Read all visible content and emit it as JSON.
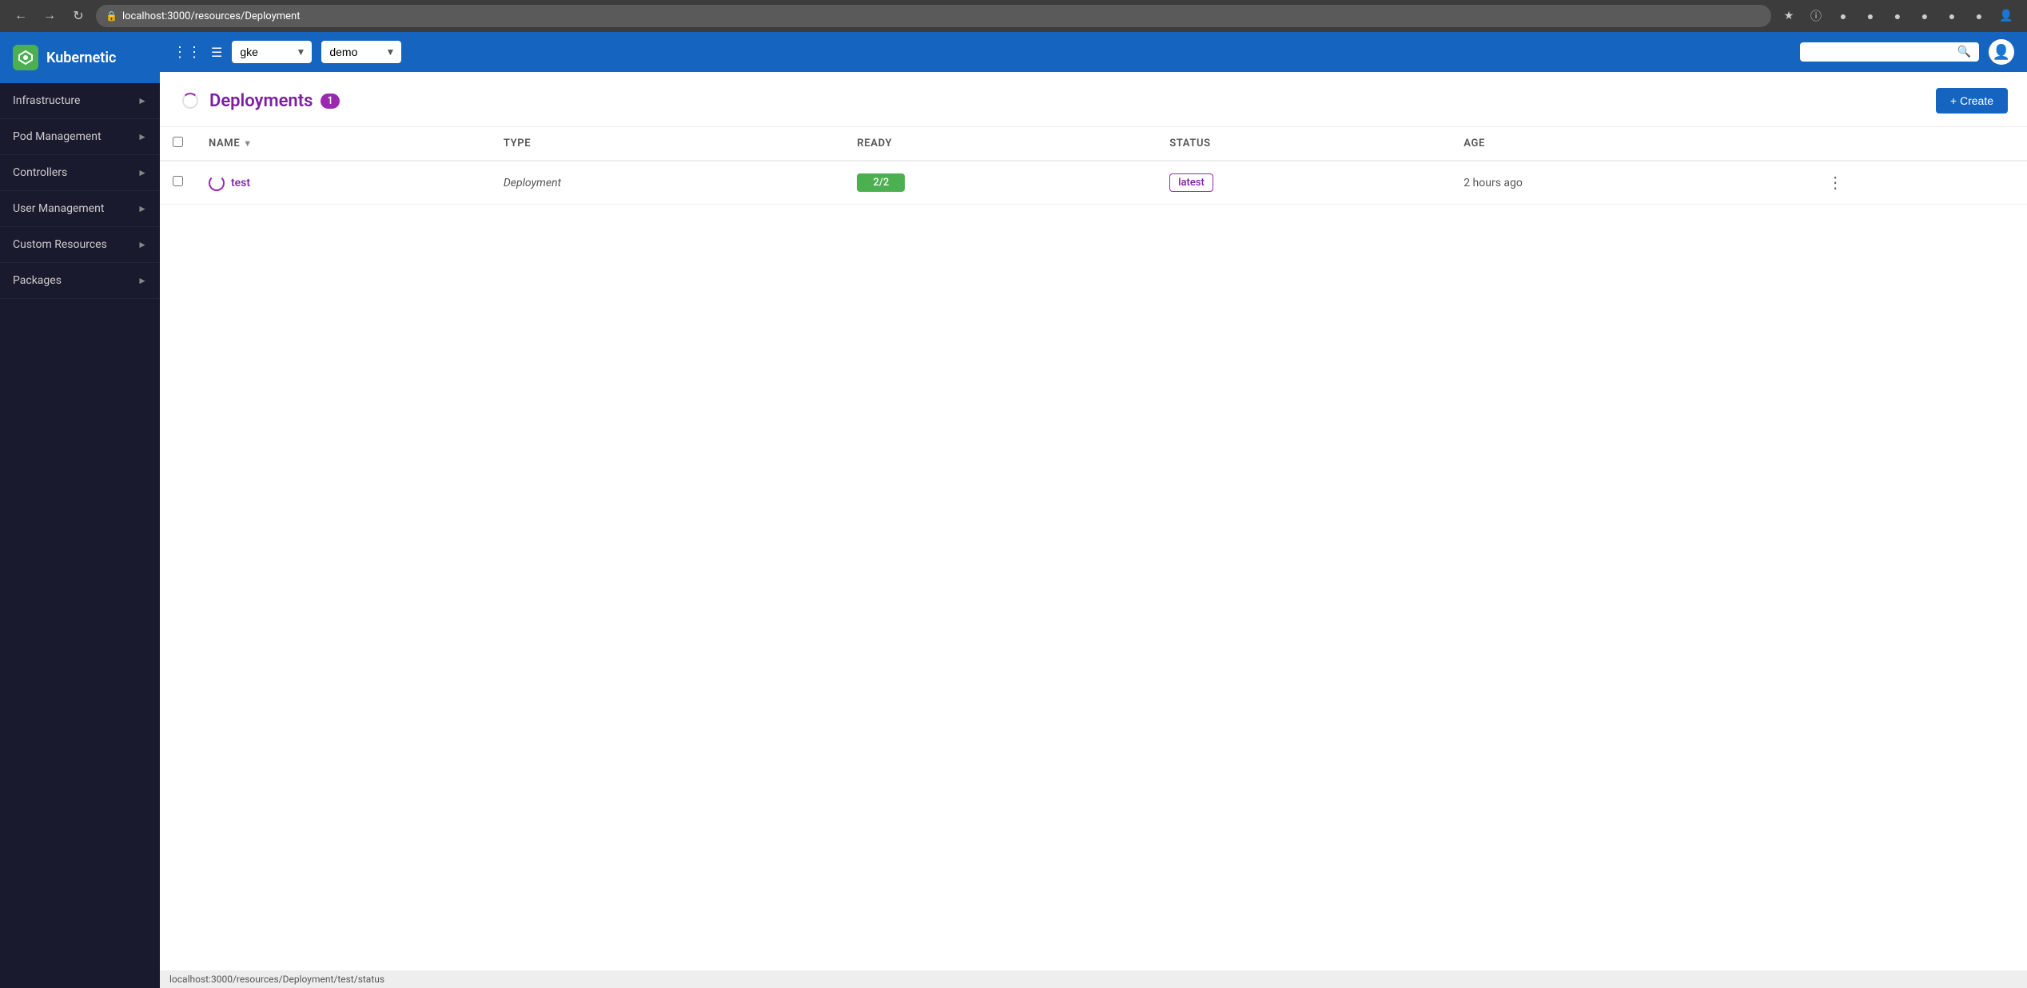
{
  "browser": {
    "url": "localhost:3000/resources/Deployment",
    "status_url": "localhost:3000/resources/Deployment/test/status"
  },
  "header": {
    "cluster_dropdown": {
      "value": "gke",
      "options": [
        "gke"
      ]
    },
    "namespace_dropdown": {
      "value": "demo",
      "options": [
        "demo"
      ]
    },
    "search_placeholder": ""
  },
  "sidebar": {
    "logo_text": "Kubernetic",
    "items": [
      {
        "label": "Infrastructure",
        "has_arrow": true
      },
      {
        "label": "Pod Management",
        "has_arrow": true
      },
      {
        "label": "Controllers",
        "has_arrow": true
      },
      {
        "label": "User Management",
        "has_arrow": true
      },
      {
        "label": "Custom Resources",
        "has_arrow": true
      },
      {
        "label": "Packages",
        "has_arrow": true
      }
    ]
  },
  "content": {
    "title": "Deployments",
    "count": "1",
    "create_btn": "+ Create"
  },
  "table": {
    "columns": [
      "NAME",
      "TYPE",
      "READY",
      "STATUS",
      "AGE"
    ],
    "rows": [
      {
        "name": "test",
        "type": "Deployment",
        "ready": "2/2",
        "status": "latest",
        "age": "2 hours ago"
      }
    ]
  }
}
